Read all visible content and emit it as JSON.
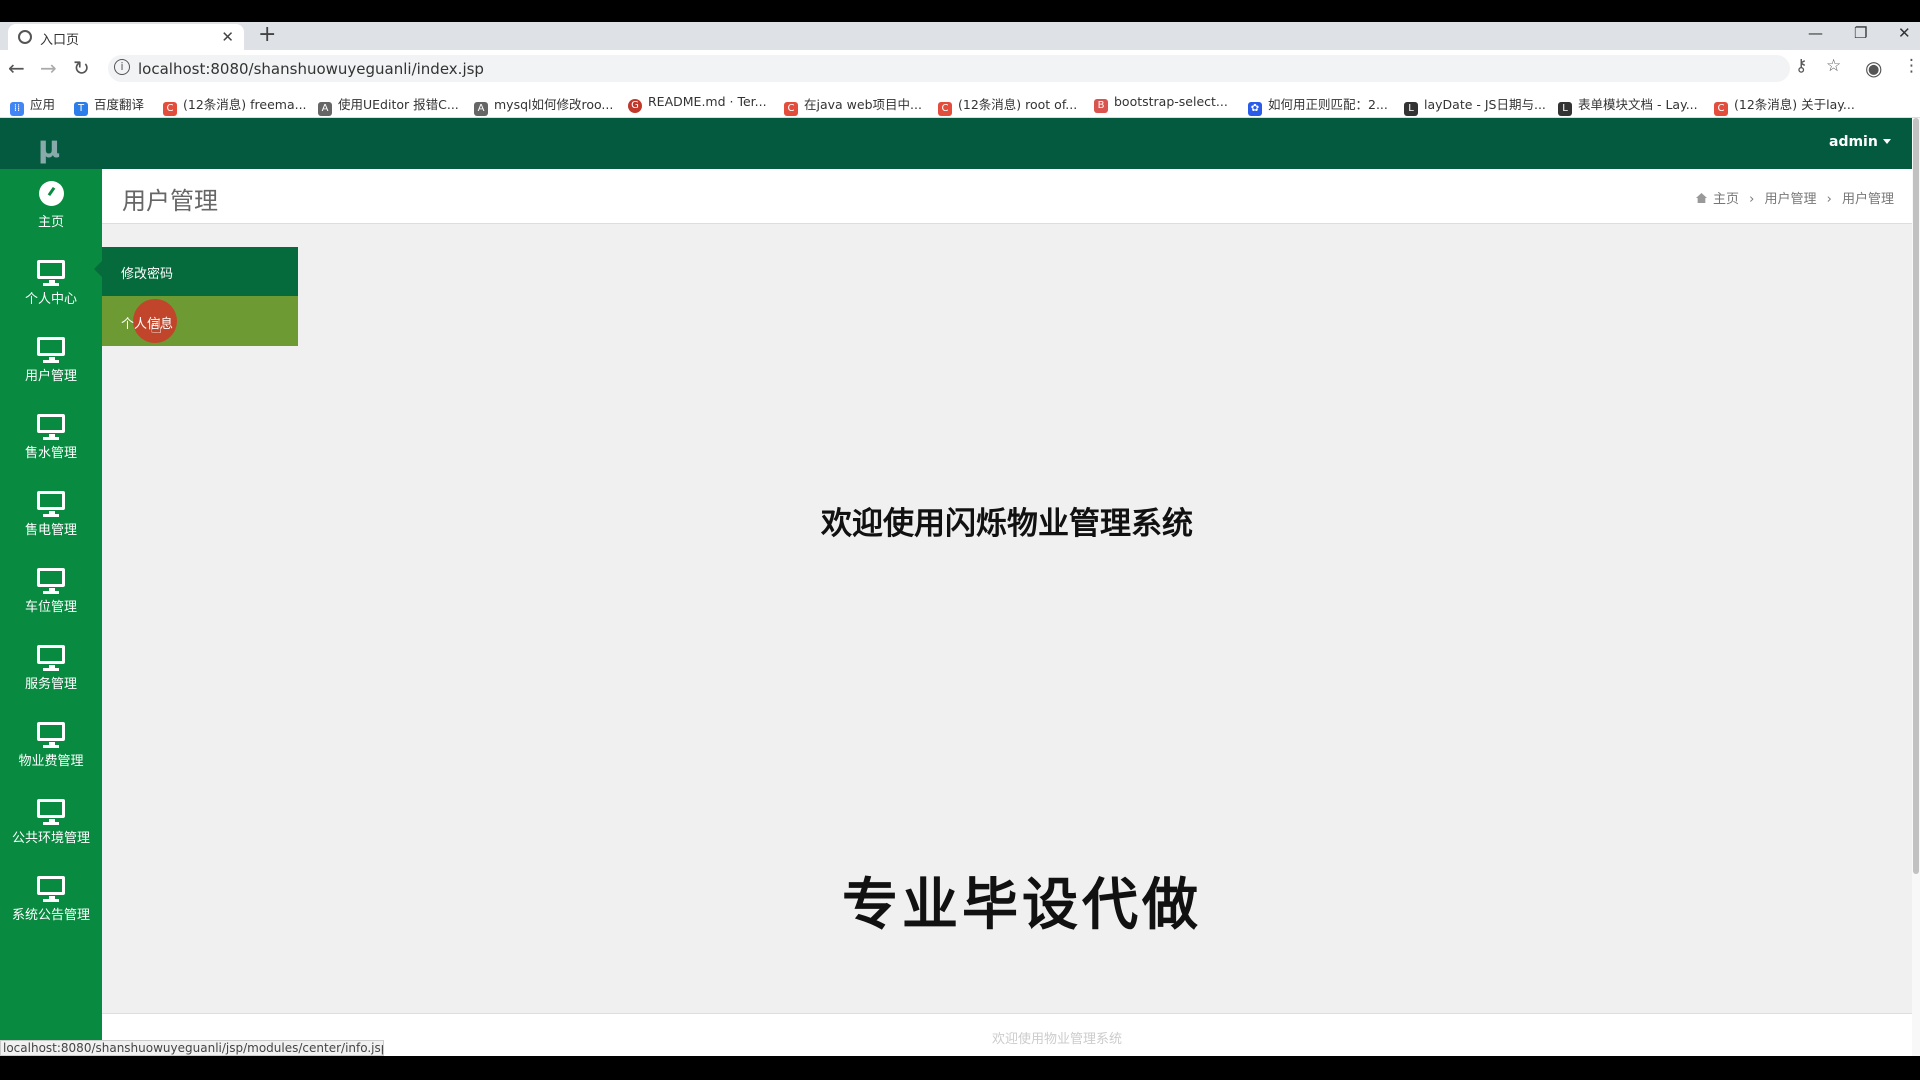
{
  "browser": {
    "tab_title": "入口页",
    "url": "localhost:8080/shanshuowuyeguanli/index.jsp",
    "status_url": "localhost:8080/shanshuowuyeguanli/jsp/modules/center/info.jsp",
    "bookmarks": [
      {
        "label": "应用",
        "icon_color": "#4285f4"
      },
      {
        "label": "百度翻译",
        "icon_color": "#2b7de9"
      },
      {
        "label": "(12条消息) freema...",
        "icon_color": "#e34d3b"
      },
      {
        "label": "使用UEditor 报错C...",
        "icon_color": "#666666"
      },
      {
        "label": "mysql如何修改roo...",
        "icon_color": "#666666"
      },
      {
        "label": "README.md · Ter...",
        "icon_color": "#c0392b"
      },
      {
        "label": "在java web项目中...",
        "icon_color": "#e34d3b"
      },
      {
        "label": "(12条消息) root of...",
        "icon_color": "#e34d3b"
      },
      {
        "label": "bootstrap-select...",
        "icon_color": "#d9534f"
      },
      {
        "label": "如何用正则匹配：2...",
        "icon_color": "#2b5ce9"
      },
      {
        "label": "layDate - JS日期与...",
        "icon_color": "#333333"
      },
      {
        "label": "表单模块文档 - Lay...",
        "icon_color": "#333333"
      },
      {
        "label": "(12条消息) 关于lay...",
        "icon_color": "#e34d3b"
      }
    ]
  },
  "app": {
    "logo": "μ",
    "user_menu": "admin",
    "sidebar": [
      {
        "label": "主页",
        "icon": "dashboard-icon"
      },
      {
        "label": "个人中心",
        "icon": "monitor-icon"
      },
      {
        "label": "用户管理",
        "icon": "monitor-icon"
      },
      {
        "label": "售水管理",
        "icon": "monitor-icon"
      },
      {
        "label": "售电管理",
        "icon": "monitor-icon"
      },
      {
        "label": "车位管理",
        "icon": "monitor-icon"
      },
      {
        "label": "服务管理",
        "icon": "monitor-icon"
      },
      {
        "label": "物业费管理",
        "icon": "monitor-icon"
      },
      {
        "label": "公共环境管理",
        "icon": "monitor-icon"
      },
      {
        "label": "系统公告管理",
        "icon": "monitor-icon"
      }
    ],
    "submenu": [
      "修改密码",
      "个人信息"
    ],
    "page_title": "用户管理",
    "breadcrumb": [
      "主页",
      "用户管理",
      "用户管理"
    ],
    "welcome": "欢迎使用闪烁物业管理系统",
    "footer": "欢迎使用物业管理系统",
    "overlay": "专业毕设代做"
  },
  "colors": {
    "topbar": "#045a3f",
    "sidebar": "#088a40",
    "submenu_active": "#6e9a33"
  }
}
